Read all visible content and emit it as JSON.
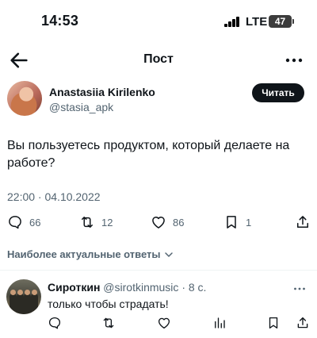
{
  "status_bar": {
    "time": "14:53",
    "network": "LTE",
    "battery": "47"
  },
  "nav": {
    "title": "Пост",
    "back_icon": "arrow-left-icon",
    "more_icon": "more-horizontal-icon"
  },
  "tweet": {
    "author_name": "Anastasiia Kirilenko",
    "author_handle": "@stasia_apk",
    "follow_label": "Читать",
    "text": "Вы пользуетесь продуктом, который делаете на работе?",
    "meta": "22:00 · 04.10.2022",
    "actions": {
      "reply_count": "66",
      "retweet_count": "12",
      "like_count": "86",
      "bookmark_count": "1"
    }
  },
  "replies_filter": {
    "label": "Наиболее актуальные ответы",
    "icon": "chevron-down-icon"
  },
  "reply": {
    "name": "Сироткин",
    "handle": "@sirotkinmusic",
    "time": "· 8 с.",
    "text": "только чтобы страдать!"
  },
  "colors": {
    "text": "#0f1419",
    "secondary": "#536471",
    "button_bg": "#0f1419",
    "divider": "#eff3f4"
  }
}
